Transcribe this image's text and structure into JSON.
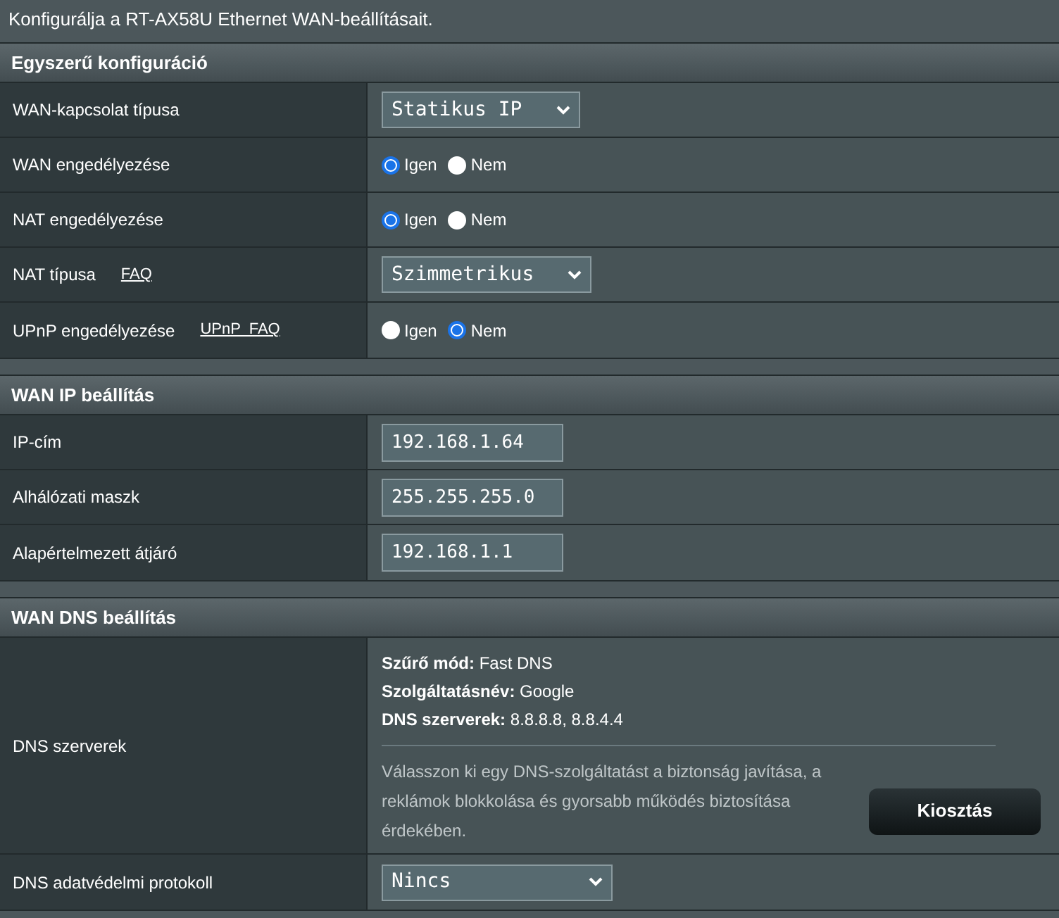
{
  "intro": "Konfigurálja a RT-AX58U Ethernet WAN-beállításait.",
  "sections": [
    {
      "title": "Egyszerű konfiguráció",
      "rows": [
        {
          "kind": "select",
          "label": "WAN-kapcsolat típusa",
          "value": "Statikus IP"
        },
        {
          "kind": "radio",
          "label": "WAN engedélyezése",
          "options": [
            {
              "label": "Igen",
              "selected": true
            },
            {
              "label": "Nem",
              "selected": false
            }
          ]
        },
        {
          "kind": "radio",
          "label": "NAT engedélyezése",
          "options": [
            {
              "label": "Igen",
              "selected": true
            },
            {
              "label": "Nem",
              "selected": false
            }
          ]
        },
        {
          "kind": "select",
          "label": "NAT típusa",
          "link": "FAQ",
          "value": "Szimmetrikus"
        },
        {
          "kind": "radio",
          "label": "UPnP engedélyezése",
          "link": "UPnP  FAQ",
          "options": [
            {
              "label": "Igen",
              "selected": false
            },
            {
              "label": "Nem",
              "selected": true
            }
          ]
        }
      ]
    },
    {
      "title": "WAN IP beállítás",
      "rows": [
        {
          "kind": "input",
          "label": "IP-cím",
          "value": "192.168.1.64"
        },
        {
          "kind": "input",
          "label": "Alhálózati maszk",
          "value": "255.255.255.0"
        },
        {
          "kind": "input",
          "label": "Alapértelmezett átjáró",
          "value": "192.168.1.1"
        }
      ]
    },
    {
      "title": "WAN DNS beállítás",
      "rows": [
        {
          "kind": "dns",
          "label": "DNS szerverek",
          "info": [
            "**Szűrő mód:** Fast DNS",
            "**Szolgáltatásnév:** Google",
            "**DNS szerverek:** 8.8.8.8, 8.8.4.4"
          ],
          "note": "Válasszon ki egy DNS-szolgáltatást a biztonság javítása, a reklámok blokkolása és gyorsabb működés biztosítása érdekében.",
          "button": "Kiosztás"
        },
        {
          "kind": "select",
          "label": "DNS adatvédelmi protokoll",
          "value": "Nincs",
          "wide": true
        }
      ]
    }
  ]
}
